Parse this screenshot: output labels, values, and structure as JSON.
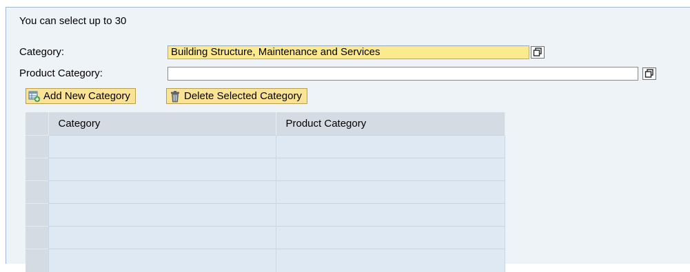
{
  "info": {
    "selection_limit_text": "You can select up to 30"
  },
  "form": {
    "category_label": "Category:",
    "category_value": "Building Structure, Maintenance and Services",
    "product_category_label": "Product Category:",
    "product_category_value": ""
  },
  "toolbar": {
    "add_label": "Add New Category",
    "add_icon": "add-row-icon",
    "delete_label": "Delete Selected Category",
    "delete_icon": "trash-icon"
  },
  "table": {
    "columns": [
      "Category",
      "Product Category"
    ],
    "rows": [
      [
        "",
        ""
      ],
      [
        "",
        ""
      ],
      [
        "",
        ""
      ],
      [
        "",
        ""
      ],
      [
        "",
        ""
      ],
      [
        "",
        ""
      ]
    ]
  },
  "colors": {
    "panel_background": "#eef3f8",
    "input_highlight": "#fde98e",
    "button_background": "#fbe396",
    "table_header": "#d4dbe2",
    "table_cell": "#dfe9f3"
  }
}
